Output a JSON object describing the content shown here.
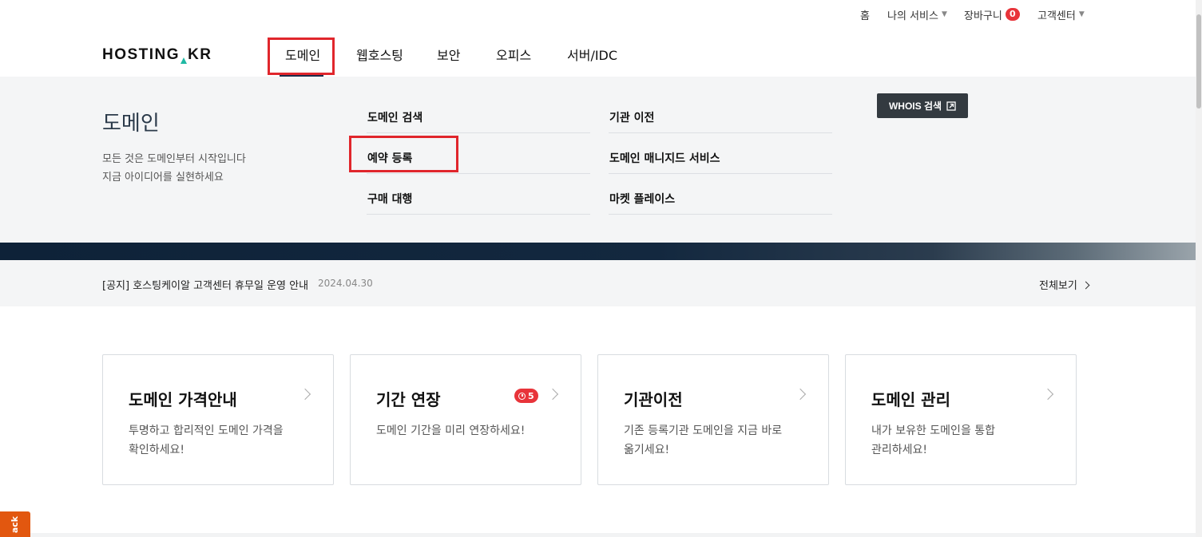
{
  "utility": {
    "home": "홈",
    "my_services": "나의 서비스",
    "cart": "장바구니",
    "cart_count": "0",
    "support": "고객센터"
  },
  "logo": {
    "part1": "HOSTING",
    "part2": "KR"
  },
  "nav": {
    "items": [
      {
        "label": "도메인"
      },
      {
        "label": "웹호스팅"
      },
      {
        "label": "보안"
      },
      {
        "label": "오피스"
      },
      {
        "label": "서버/IDC"
      }
    ]
  },
  "mega": {
    "title": "도메인",
    "desc_line1": "모든 것은 도메인부터 시작입니다",
    "desc_line2": "지금 아이디어를 실현하세요",
    "col1": [
      {
        "label": "도메인 검색"
      },
      {
        "label": "예약 등록"
      },
      {
        "label": "구매 대행"
      }
    ],
    "col2": [
      {
        "label": "기관 이전"
      },
      {
        "label": "도메인 매니지드 서비스"
      },
      {
        "label": "마켓 플레이스"
      }
    ],
    "whois_button": "WHOIS 검색"
  },
  "notice": {
    "text": "[공지] 호스팅케이알 고객센터 휴무일 운영 안내",
    "date": "2024.04.30",
    "view_all": "전체보기"
  },
  "cards": [
    {
      "title": "도메인 가격안내",
      "desc1": "투명하고 합리적인 도메인 가격을",
      "desc2": "확인하세요!"
    },
    {
      "title": "기간 연장",
      "desc1": "도메인 기간을 미리 연장하세요!",
      "desc2": "",
      "badge": "5"
    },
    {
      "title": "기관이전",
      "desc1": "기존 등록기관 도메인을 지금 바로",
      "desc2": "옮기세요!"
    },
    {
      "title": "도메인 관리",
      "desc1": "내가 보유한 도메인을 통합",
      "desc2": "관리하세요!"
    }
  ],
  "feedback": "ack",
  "colors": {
    "accent_red": "#e0262c",
    "badge_red": "#e8343a",
    "navy": "#1c2b4a",
    "feedback_orange": "#e2570f"
  }
}
